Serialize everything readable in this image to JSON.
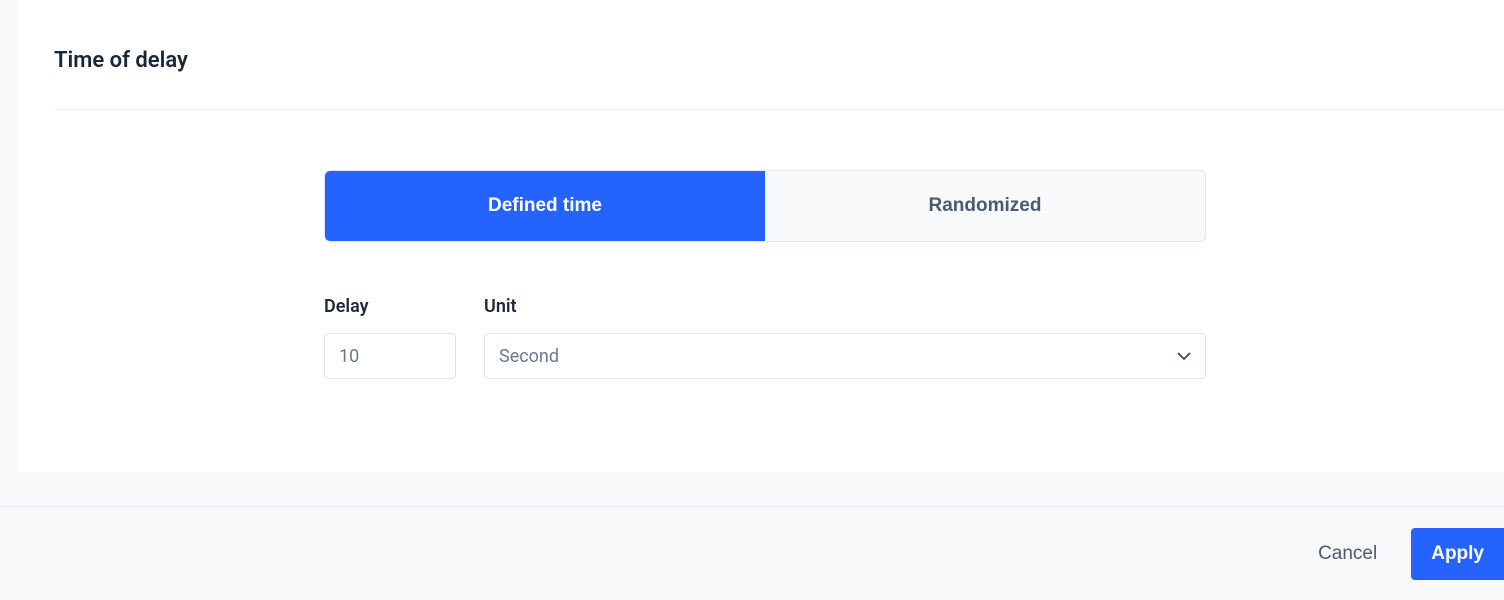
{
  "card": {
    "title": "Time of delay"
  },
  "tabs": {
    "defined": "Defined time",
    "randomized": "Randomized"
  },
  "form": {
    "delay_label": "Delay",
    "delay_value": "10",
    "unit_label": "Unit",
    "unit_value": "Second"
  },
  "footer": {
    "cancel": "Cancel",
    "apply": "Apply"
  }
}
